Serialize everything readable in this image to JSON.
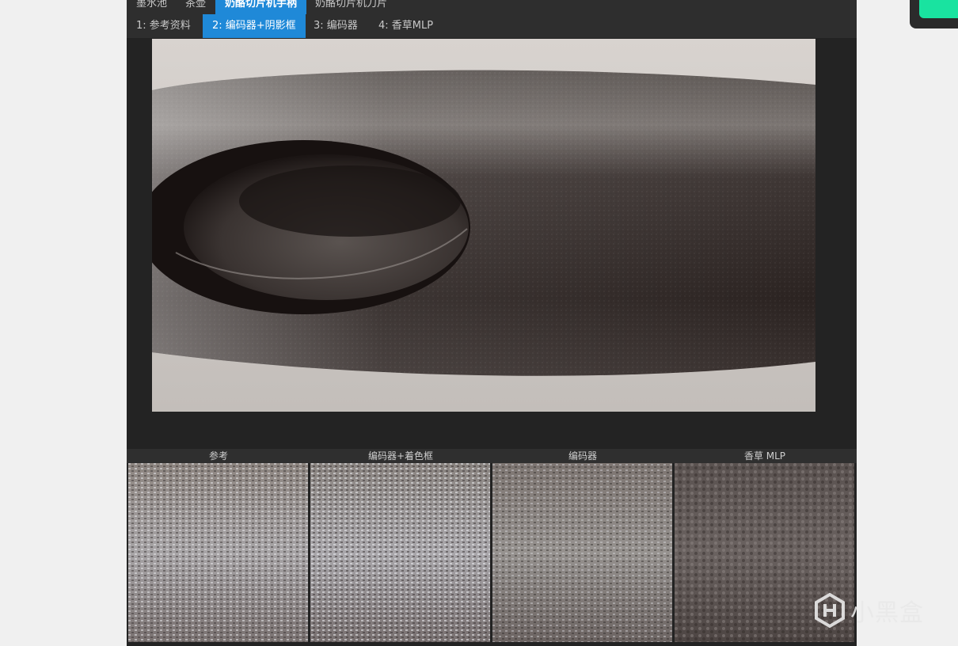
{
  "top_tabs": [
    {
      "label": "墨水池",
      "active": false
    },
    {
      "label": "茶壶",
      "active": false
    },
    {
      "label": "奶酪切片机手柄",
      "active": true
    },
    {
      "label": "奶酪切片机刀片",
      "active": false
    }
  ],
  "mode_tabs": [
    {
      "label": "1: 参考资料",
      "active": false
    },
    {
      "label": "2: 编码器+阴影框",
      "active": true
    },
    {
      "label": "3: 编码器",
      "active": false
    },
    {
      "label": "4: 香草MLP",
      "active": false
    }
  ],
  "comparison": {
    "columns": [
      {
        "label": "参考"
      },
      {
        "label": "编码器+着色框"
      },
      {
        "label": "编码器"
      },
      {
        "label": "香草 MLP"
      }
    ]
  },
  "watermark": {
    "text": "小黑盒"
  },
  "colors": {
    "accent": "#1f89d8",
    "float_button": "#19e3a0",
    "panel_bg": "#232323",
    "tab_bar_bg": "#2e2e2e"
  }
}
